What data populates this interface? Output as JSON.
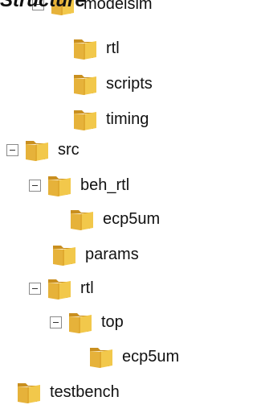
{
  "heading": "Structure",
  "colors": {
    "folder_front": "#f2c84b",
    "folder_back": "#c98f1f",
    "folder_shade": "#e0a92f",
    "text": "#111111"
  },
  "tree": {
    "modelsim": {
      "label": "modelsim",
      "expanded": true
    },
    "modelsim_rtl": {
      "label": "rtl"
    },
    "modelsim_scripts": {
      "label": "scripts"
    },
    "modelsim_timing": {
      "label": "timing"
    },
    "src": {
      "label": "src",
      "expanded": true
    },
    "src_beh_rtl": {
      "label": "beh_rtl",
      "expanded": true
    },
    "src_beh_rtl_ecp5um": {
      "label": "ecp5um"
    },
    "src_params": {
      "label": "params"
    },
    "src_rtl": {
      "label": "rtl",
      "expanded": true
    },
    "src_rtl_top": {
      "label": "top",
      "expanded": true
    },
    "src_rtl_top_ecp5um": {
      "label": "ecp5um"
    },
    "testbench": {
      "label": "testbench"
    }
  }
}
